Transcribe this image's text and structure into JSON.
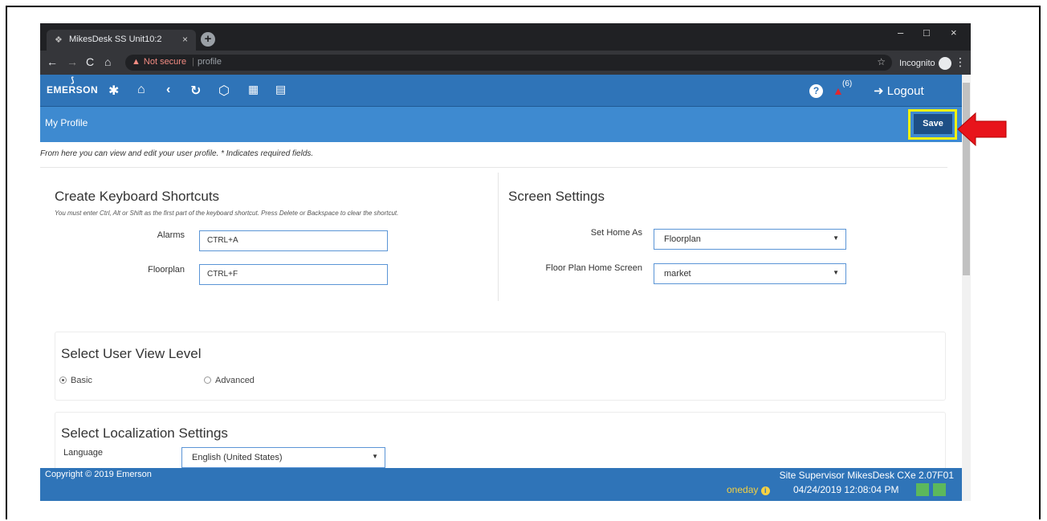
{
  "browser": {
    "tab_title": "MikesDesk SS Unit10:2",
    "tab_close": "×",
    "new_tab": "+",
    "address_warning": "Not secure",
    "address_path": "profile",
    "incognito_label": "Incognito",
    "window_controls": [
      "–",
      "□",
      "×"
    ]
  },
  "header": {
    "logo_text": "EMERSON",
    "notification_count": "(6)",
    "logout_label": "Logout",
    "help_label": "?",
    "icons": [
      "gear-icon",
      "home-icon",
      "back-icon",
      "refresh-icon",
      "cube-icon",
      "calendar-icon",
      "map-icon"
    ]
  },
  "subheader": {
    "title": "My Profile",
    "save_label": "Save"
  },
  "intro_text": "From here you can view and edit your user profile. * Indicates required fields.",
  "shortcuts": {
    "title": "Create Keyboard Shortcuts",
    "note": "You must enter Ctrl, Alt or Shift as the first part of the keyboard shortcut. Press Delete or Backspace to clear the shortcut.",
    "alarms_label": "Alarms",
    "alarms_value": "CTRL+A",
    "floorplan_label": "Floorplan",
    "floorplan_value": "CTRL+F"
  },
  "screen_settings": {
    "title": "Screen Settings",
    "home_label": "Set Home As",
    "home_value": "Floorplan",
    "floorplan_home_label": "Floor Plan Home Screen",
    "floorplan_home_value": "market"
  },
  "view_level": {
    "title": "Select User View Level",
    "options": [
      "Basic",
      "Advanced"
    ],
    "selected": "Basic"
  },
  "localization": {
    "title": "Select Localization Settings",
    "language_label": "Language",
    "language_value": "English (United States)"
  },
  "footer": {
    "copyright": "Copyright © 2019 Emerson",
    "site_info": "Site Supervisor MikesDesk CXe 2.07F01",
    "oneday": "oneday",
    "datetime": "04/24/2019 12:08:04 PM"
  },
  "colors": {
    "header_blue": "#2f74b8",
    "subheader_blue": "#3e8ad0",
    "save_button": "#1d4f86",
    "highlight_yellow": "#f4f20a",
    "arrow_red": "#e8141b",
    "status_green": "#5cb85c"
  }
}
